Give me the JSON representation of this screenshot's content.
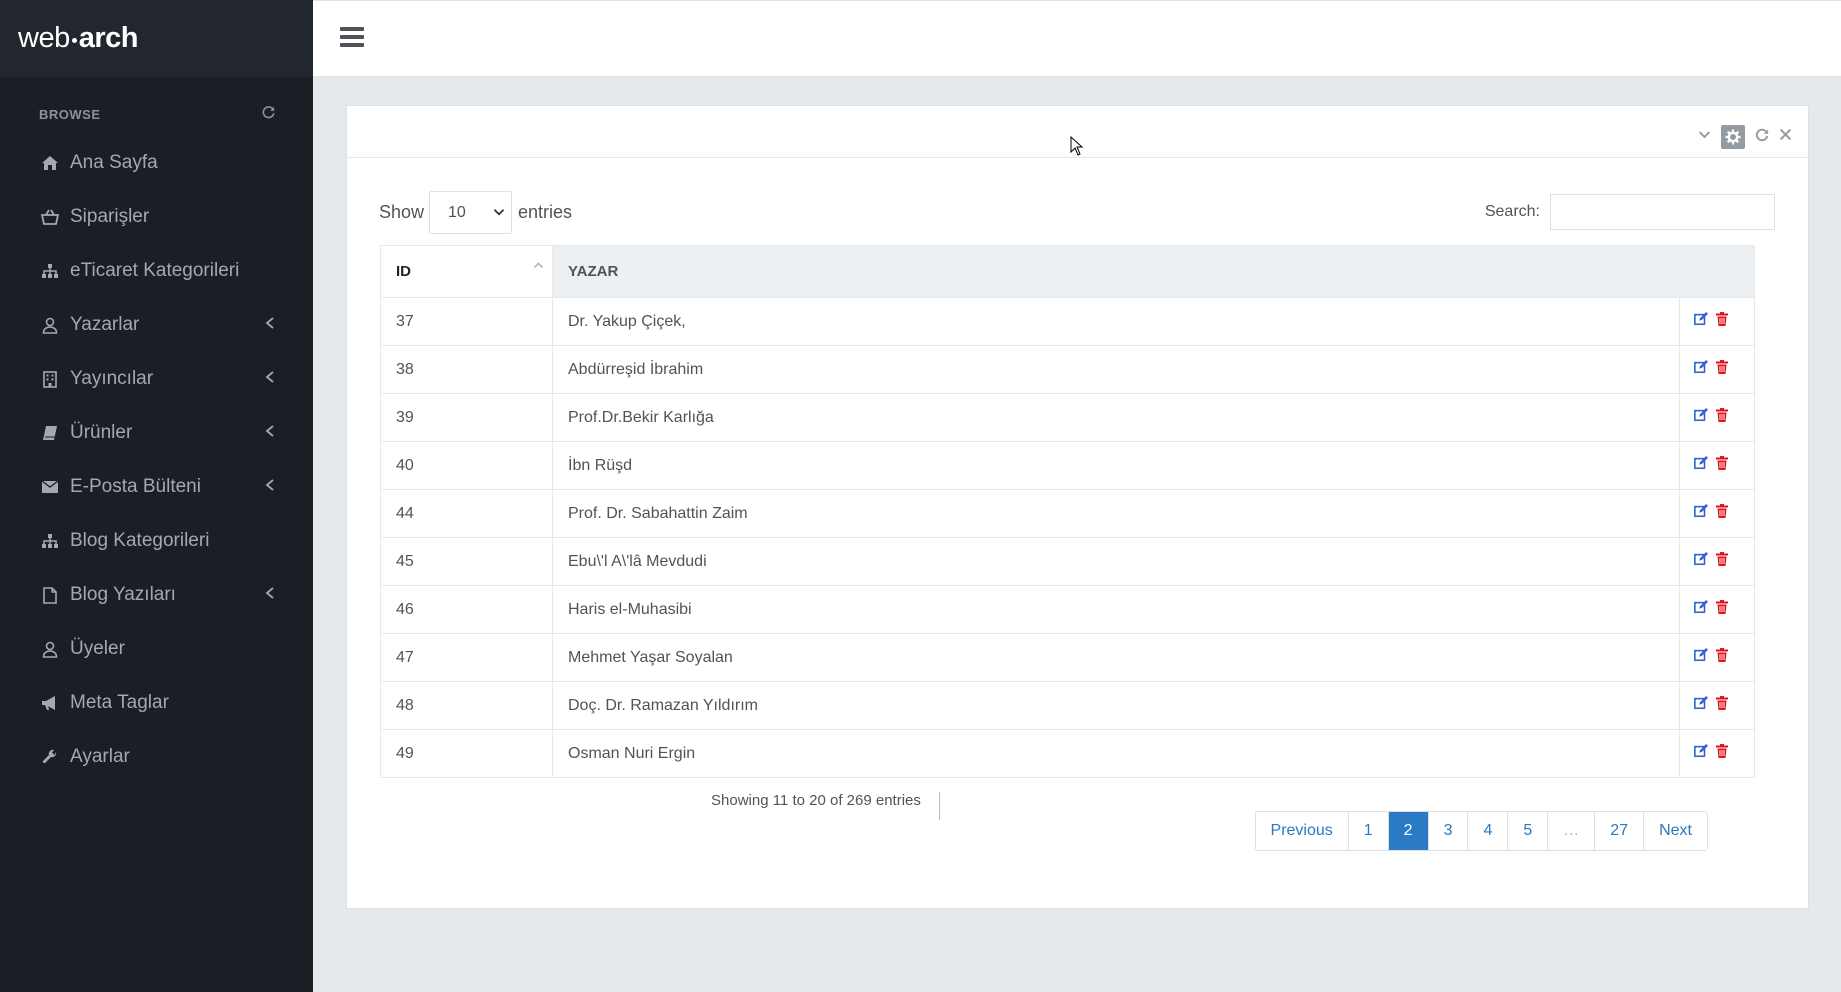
{
  "brand": {
    "part1": "web",
    "part2": "arch"
  },
  "sidebar": {
    "section_label": "BROWSE",
    "items": [
      {
        "label": "Ana Sayfa",
        "icon": "home-icon",
        "has_arrow": false
      },
      {
        "label": "Siparişler",
        "icon": "basket-icon",
        "has_arrow": false
      },
      {
        "label": "eTicaret Kategorileri",
        "icon": "sitemap-icon",
        "has_arrow": false
      },
      {
        "label": "Yazarlar",
        "icon": "user-icon",
        "has_arrow": true
      },
      {
        "label": "Yayıncılar",
        "icon": "building-icon",
        "has_arrow": true
      },
      {
        "label": "Ürünler",
        "icon": "book-icon",
        "has_arrow": true
      },
      {
        "label": "E-Posta Bülteni",
        "icon": "envelope-icon",
        "has_arrow": true
      },
      {
        "label": "Blog Kategorileri",
        "icon": "sitemap-icon",
        "has_arrow": false
      },
      {
        "label": "Blog Yazıları",
        "icon": "file-icon",
        "has_arrow": true
      },
      {
        "label": "Üyeler",
        "icon": "user-icon",
        "has_arrow": false
      },
      {
        "label": "Meta Taglar",
        "icon": "bullhorn-icon",
        "has_arrow": false
      },
      {
        "label": "Ayarlar",
        "icon": "wrench-icon",
        "has_arrow": false
      }
    ]
  },
  "table_controls": {
    "show_label": "Show",
    "entries_value": "10",
    "entries_label": "entries",
    "search_label": "Search:",
    "search_value": ""
  },
  "table": {
    "columns": [
      "ID",
      "YAZAR"
    ],
    "rows": [
      {
        "id": "37",
        "yazar": "Dr. Yakup Çiçek,"
      },
      {
        "id": "38",
        "yazar": "Abdürreşid İbrahim"
      },
      {
        "id": "39",
        "yazar": "Prof.Dr.Bekir Karlığa"
      },
      {
        "id": "40",
        "yazar": "İbn Rüşd"
      },
      {
        "id": "44",
        "yazar": "Prof. Dr. Sabahattin Zaim"
      },
      {
        "id": "45",
        "yazar": "Ebu\\'l A\\'lâ Mevdudi"
      },
      {
        "id": "46",
        "yazar": "Haris el-Muhasibi"
      },
      {
        "id": "47",
        "yazar": "Mehmet Yaşar Soyalan"
      },
      {
        "id": "48",
        "yazar": "Doç. Dr. Ramazan Yıldırım"
      },
      {
        "id": "49",
        "yazar": "Osman Nuri Ergin"
      }
    ]
  },
  "info_text": "Showing 11 to 20 of 269 entries",
  "pagination": {
    "previous": "Previous",
    "pages": [
      "1",
      "2",
      "3",
      "4",
      "5",
      "…",
      "27"
    ],
    "active": "2",
    "next": "Next"
  },
  "colors": {
    "sidebar_bg": "#1b1e24",
    "accent": "#2b7bc4",
    "edit_icon": "#2e60d8",
    "delete_icon": "#e0141c"
  }
}
